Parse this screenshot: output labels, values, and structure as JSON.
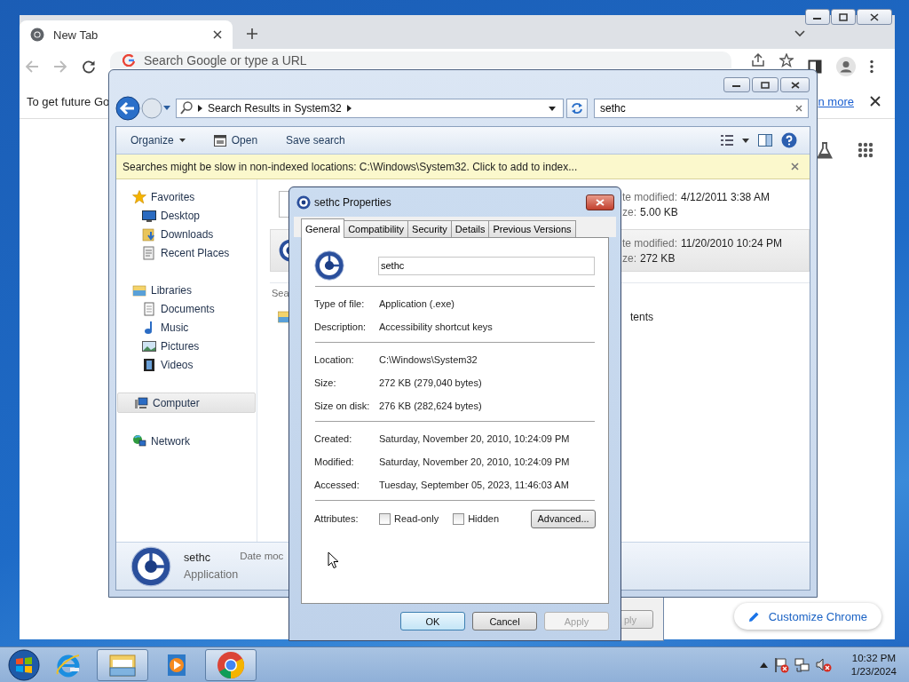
{
  "chrome": {
    "tab": {
      "title": "New Tab"
    },
    "omnibox": {
      "placeholder": "Search Google or type a URL"
    },
    "infobar": {
      "text": "To get future Go",
      "link": "n more"
    },
    "customize_button": "Customize Chrome"
  },
  "back_dialog": {
    "button": "ply"
  },
  "explorer": {
    "address": {
      "crumb": "Search Results in System32"
    },
    "search": {
      "value": "sethc"
    },
    "toolbar": {
      "organize": "Organize",
      "open": "Open",
      "save_search": "Save search"
    },
    "info_bar": "Searches might be slow in non-indexed locations: C:\\Windows\\System32. Click to add to index...",
    "nav": [
      {
        "label": "Favorites",
        "kind": "star",
        "selected": false,
        "children": [
          {
            "label": "Desktop",
            "kind": "desktop",
            "selected": false
          },
          {
            "label": "Downloads",
            "kind": "downloads",
            "selected": false
          },
          {
            "label": "Recent Places",
            "kind": "recent",
            "selected": false
          }
        ]
      },
      {
        "label": "Libraries",
        "kind": "library",
        "selected": false,
        "children": [
          {
            "label": "Documents",
            "kind": "documents",
            "selected": false
          },
          {
            "label": "Music",
            "kind": "music",
            "selected": false
          },
          {
            "label": "Pictures",
            "kind": "pictures",
            "selected": false
          },
          {
            "label": "Videos",
            "kind": "videos",
            "selected": false
          }
        ]
      },
      {
        "label": "Computer",
        "kind": "computer",
        "selected": true
      },
      {
        "label": "Network",
        "kind": "network",
        "selected": false
      }
    ],
    "results": [
      {
        "selected": false,
        "modified_label": "te modified:",
        "modified": "4/12/2011 3:38 AM",
        "size_label": "ze:",
        "size": "5.00 KB"
      },
      {
        "selected": true,
        "modified_label": "te modified:",
        "modified": "11/20/2010 10:24 PM",
        "size_label": "ze:",
        "size": "272 KB"
      }
    ],
    "search_again": "Sea",
    "contents": "tents",
    "details": {
      "name": "sethc",
      "type": "Application",
      "date_label": "Date moc"
    }
  },
  "properties": {
    "title": "sethc Properties",
    "tabs": [
      {
        "label": "General",
        "selected": true
      },
      {
        "label": "Compatibility",
        "selected": false
      },
      {
        "label": "Security",
        "selected": false
      },
      {
        "label": "Details",
        "selected": false
      },
      {
        "label": "Previous Versions",
        "selected": false
      }
    ],
    "name": "sethc",
    "sections": [
      [
        {
          "label": "Type of file:",
          "value": "Application (.exe)"
        },
        {
          "label": "Description:",
          "value": "Accessibility shortcut keys"
        }
      ],
      [
        {
          "label": "Location:",
          "value": "C:\\Windows\\System32"
        },
        {
          "label": "Size:",
          "value": "272 KB (279,040 bytes)"
        },
        {
          "label": "Size on disk:",
          "value": "276 KB (282,624 bytes)"
        }
      ],
      [
        {
          "label": "Created:",
          "value": "Saturday, November 20, 2010, 10:24:09 PM"
        },
        {
          "label": "Modified:",
          "value": "Saturday, November 20, 2010, 10:24:09 PM"
        },
        {
          "label": "Accessed:",
          "value": "Tuesday, September 05, 2023, 11:46:03 AM"
        }
      ]
    ],
    "attributes": {
      "label": "Attributes:",
      "checkboxes": [
        {
          "label": "Read-only",
          "checked": false
        },
        {
          "label": "Hidden",
          "checked": false
        }
      ],
      "advanced": "Advanced..."
    },
    "buttons": [
      {
        "label": "OK",
        "default": true,
        "disabled": false
      },
      {
        "label": "Cancel",
        "default": false,
        "disabled": false
      },
      {
        "label": "Apply",
        "default": false,
        "disabled": true
      }
    ]
  },
  "taskbar": {
    "apps": [
      {
        "kind": "ie",
        "running": false
      },
      {
        "kind": "explorer",
        "running": true
      },
      {
        "kind": "media",
        "running": false
      },
      {
        "kind": "chrome",
        "running": true
      }
    ],
    "clock": {
      "time": "10:32 PM",
      "date": "1/23/2024"
    }
  }
}
